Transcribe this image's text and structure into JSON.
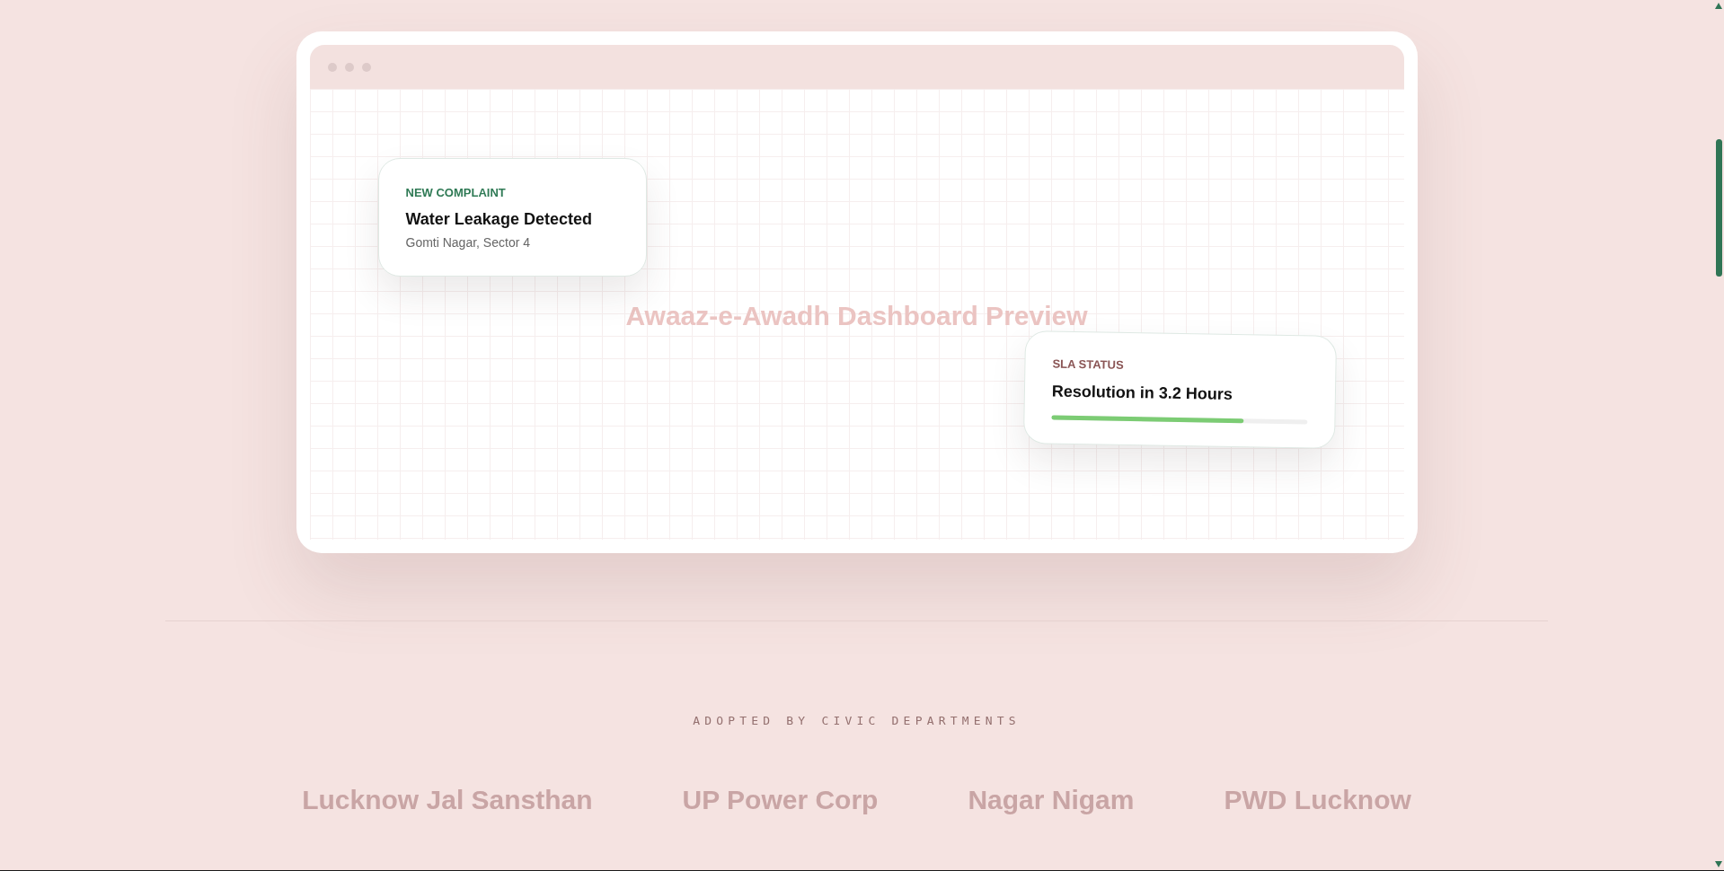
{
  "preview": {
    "title": "Awaaz-e-Awadh Dashboard Preview",
    "cards": [
      {
        "kind": "complaint",
        "tag": "NEW COMPLAINT",
        "title": "Water Leakage Detected",
        "location": "Gomti Nagar, Sector 4"
      },
      {
        "kind": "sla",
        "tag": "SLA STATUS",
        "title": "Resolution in 3.2 Hours",
        "level": 0.75
      }
    ]
  },
  "partners": {
    "heading": "ADOPTED BY CIVIC DEPARTMENTS",
    "items": [
      "Lucknow Jal Sansthan",
      "UP Power Corp",
      "Nagar Nigam",
      "PWD Lucknow"
    ]
  }
}
